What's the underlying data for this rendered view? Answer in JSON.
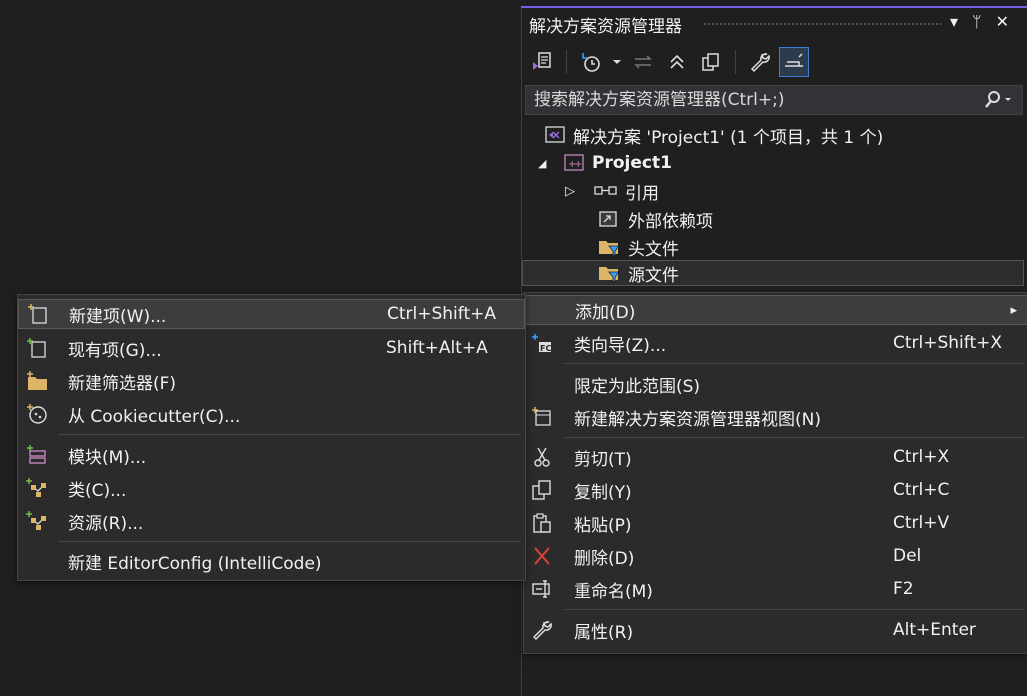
{
  "solution_explorer": {
    "title": "解决方案资源管理器",
    "title_controls": [
      "▾",
      "ᛘ",
      "✕"
    ],
    "search": {
      "placeholder": "搜索解决方案资源管理器(Ctrl+;)",
      "value": ""
    },
    "tree": [
      {
        "label": "解决方案 'Project1' (1 个项目，共 1 个)",
        "icon": "solution-icon"
      },
      {
        "label": "Project1",
        "icon": "cpp-project-icon",
        "expander": "◢"
      },
      {
        "label": "引用",
        "icon": "references-icon",
        "expander": "▷"
      },
      {
        "label": "外部依赖项",
        "icon": "external-deps-icon"
      },
      {
        "label": "头文件",
        "icon": "filter-folder-icon"
      },
      {
        "label": "源文件",
        "icon": "filter-folder-icon"
      }
    ]
  },
  "context_menu": {
    "items": [
      {
        "label": "添加(D)",
        "shortcut": "",
        "arrow": "▸",
        "icon": ""
      },
      {
        "label": "类向导(Z)...",
        "shortcut": "Ctrl+Shift+X",
        "icon": "class-wizard-icon"
      },
      {
        "label": "限定为此范围(S)",
        "shortcut": "",
        "icon": ""
      },
      {
        "label": "新建解决方案资源管理器视图(N)",
        "shortcut": "",
        "icon": "new-view-icon"
      },
      {
        "label": "剪切(T)",
        "shortcut": "Ctrl+X",
        "icon": "cut-icon"
      },
      {
        "label": "复制(Y)",
        "shortcut": "Ctrl+C",
        "icon": "copy-icon"
      },
      {
        "label": "粘贴(P)",
        "shortcut": "Ctrl+V",
        "icon": "paste-icon"
      },
      {
        "label": "删除(D)",
        "shortcut": "Del",
        "icon": "delete-icon"
      },
      {
        "label": "重命名(M)",
        "shortcut": "F2",
        "icon": "rename-icon"
      },
      {
        "label": "属性(R)",
        "shortcut": "Alt+Enter",
        "icon": "properties-icon"
      }
    ]
  },
  "add_submenu": {
    "items": [
      {
        "label": "新建项(W)...",
        "shortcut": "Ctrl+Shift+A",
        "icon": "new-item-icon"
      },
      {
        "label": "现有项(G)...",
        "shortcut": "Shift+Alt+A",
        "icon": "existing-item-icon"
      },
      {
        "label": "新建筛选器(F)",
        "shortcut": "",
        "icon": "new-filter-icon"
      },
      {
        "label": "从 Cookiecutter(C)...",
        "shortcut": "",
        "icon": "cookiecutter-icon"
      },
      {
        "label": "模块(M)...",
        "shortcut": "",
        "icon": "module-icon"
      },
      {
        "label": "类(C)...",
        "shortcut": "",
        "icon": "class-icon"
      },
      {
        "label": "资源(R)...",
        "shortcut": "",
        "icon": "resource-icon"
      },
      {
        "label": "新建 EditorConfig (IntelliCode)",
        "shortcut": "",
        "icon": ""
      }
    ]
  },
  "colors": {
    "accent": "#7160e8",
    "background": "#1f1f1f",
    "menu_bg": "#2b2b2b",
    "delete_red": "#e0403a"
  }
}
